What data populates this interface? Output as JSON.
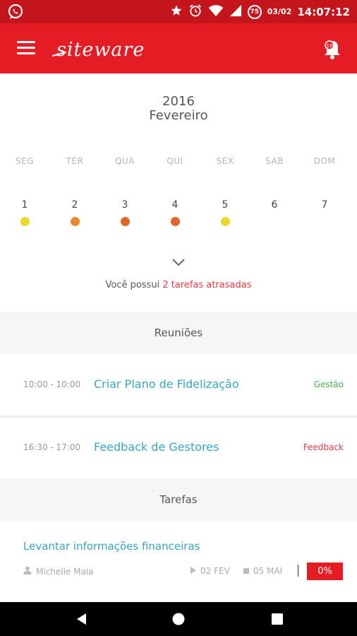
{
  "status_bar": {
    "date": "03/02",
    "time": "14:07:12",
    "badge": "75",
    "icons": [
      "whatsapp-icon",
      "star-icon",
      "alarm-icon",
      "wifi-icon",
      "signal-icon",
      "battery-icon"
    ]
  },
  "app_bar": {
    "logo_text": "siteware",
    "icons": [
      "menu-icon",
      "notification-bell-icon"
    ]
  },
  "calendar": {
    "year": "2016",
    "month": "Fevereiro",
    "weekdays": [
      "SEG",
      "TER",
      "QUA",
      "QUI",
      "SEX",
      "SAB",
      "DOM"
    ],
    "days": [
      {
        "num": "1",
        "dot": "#e8d92b"
      },
      {
        "num": "2",
        "dot": "#ea8a30"
      },
      {
        "num": "3",
        "dot": "#e0662b"
      },
      {
        "num": "4",
        "dot": "#e0662b"
      },
      {
        "num": "5",
        "dot": "#e8d92b"
      },
      {
        "num": "6",
        "dot": null
      },
      {
        "num": "7",
        "dot": null
      }
    ],
    "late_prefix": "Você possui",
    "late_link": "2 tarefas atrasadas"
  },
  "meetings": {
    "header": "Reuniões",
    "items": [
      {
        "time": "10:00 - 10:00",
        "title": "Criar Plano de Fidelização",
        "tag": "Gestão",
        "tag_color": "#4caf50"
      },
      {
        "time": "16:30 - 17:00",
        "title": "Feedback de Gestores",
        "tag": "Feedback",
        "tag_color": "#e23b43"
      }
    ]
  },
  "tasks": {
    "header": "Tarefas",
    "items": [
      {
        "title": "Levantar informações financeiras",
        "owner": "Michelle Maia",
        "start": "02 FEV",
        "end": "05 MAI",
        "progress": "0%"
      }
    ]
  },
  "colors": {
    "status_bar": "#c4151c",
    "app_bar": "#e41d24",
    "link": "#3aa5c4",
    "alert": "#e23b43"
  }
}
